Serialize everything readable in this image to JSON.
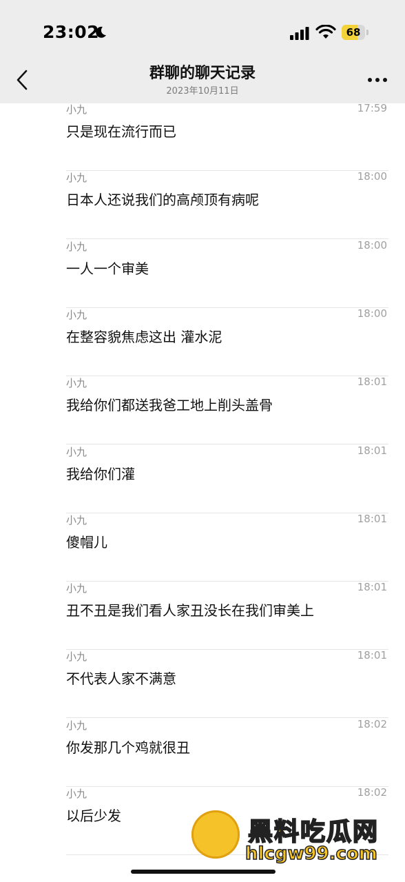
{
  "status_bar": {
    "time": "23:02",
    "battery_level": "68",
    "battery_fraction": 0.68,
    "icons": [
      "moon-icon",
      "signal-icon",
      "wifi-icon",
      "battery-icon"
    ]
  },
  "nav": {
    "title": "群聊的聊天记录",
    "date": "2023年10月11日",
    "back_icon": "chevron-left-icon",
    "more_icon": "more-dots-icon"
  },
  "messages": [
    {
      "sender": "小九",
      "time": "17:59",
      "text": "只是现在流行而已"
    },
    {
      "sender": "小九",
      "time": "18:00",
      "text": "日本人还说我们的高颅顶有病呢"
    },
    {
      "sender": "小九",
      "time": "18:00",
      "text": "一人一个审美"
    },
    {
      "sender": "小九",
      "time": "18:00",
      "text": "在整容貌焦虑这出 灌水泥"
    },
    {
      "sender": "小九",
      "time": "18:01",
      "text": "我给你们都送我爸工地上削头盖骨"
    },
    {
      "sender": "小九",
      "time": "18:01",
      "text": "我给你们灌"
    },
    {
      "sender": "小九",
      "time": "18:01",
      "text": "傻帽儿"
    },
    {
      "sender": "小九",
      "time": "18:01",
      "text": "丑不丑是我们看人家丑没长在我们审美上"
    },
    {
      "sender": "小九",
      "time": "18:01",
      "text": "不代表人家不满意"
    },
    {
      "sender": "小九",
      "time": "18:02",
      "text": "你发那几个鸡就很丑"
    },
    {
      "sender": "小九",
      "time": "18:02",
      "text": "以后少发"
    }
  ],
  "watermark": {
    "title": "黑料吃瓜网",
    "url": "hlcgw99.com"
  },
  "colors": {
    "header_bg": "#ededed",
    "battery": "#f4d23a",
    "watermark": "#f7c526"
  }
}
